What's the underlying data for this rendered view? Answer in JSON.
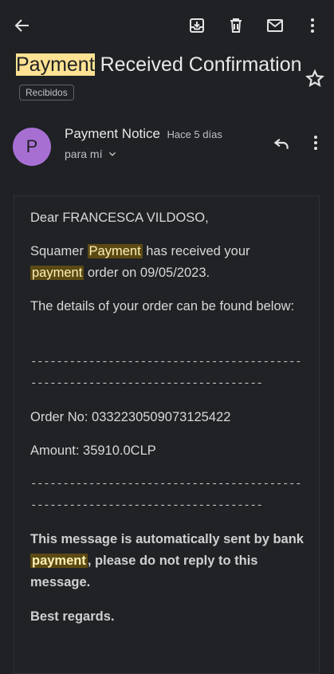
{
  "subject": {
    "highlight": "Payment",
    "rest": " Received Confirmation",
    "label": "Recibidos"
  },
  "sender": {
    "initial": "P",
    "name": "Payment Notice",
    "time": "Hace 5 días",
    "recipient": "para mí"
  },
  "message": {
    "greeting": "Dear FRANCESCA VILDOSO,",
    "p1_a": "Squamer ",
    "p1_hl1": "Payment",
    "p1_b": " has received your ",
    "p1_hl2": "payment",
    "p1_c": " order on 09/05/2023.",
    "p2": "The details of your order can be found below:",
    "divider": "------------------------------------------------------------------------------",
    "order": "Order No: 0332230509073125422",
    "amount": "Amount: 35910.0CLP",
    "auto_a": "This message is automatically sent by bank ",
    "auto_hl": "payment",
    "auto_b": ", please do not reply to this message.",
    "regards": "Best regards."
  },
  "icons": {
    "back": "arrow-back-icon",
    "archive": "archive-icon",
    "delete": "trash-icon",
    "mark_unread": "mail-icon",
    "more": "more-vert-icon",
    "star": "star-outline-icon",
    "reply": "reply-icon",
    "expand": "chevron-down-icon"
  },
  "colors": {
    "background": "#1f2124",
    "avatar": "#a86fd3",
    "title_highlight": "#fde293",
    "body_highlight": "#5b4a13"
  }
}
